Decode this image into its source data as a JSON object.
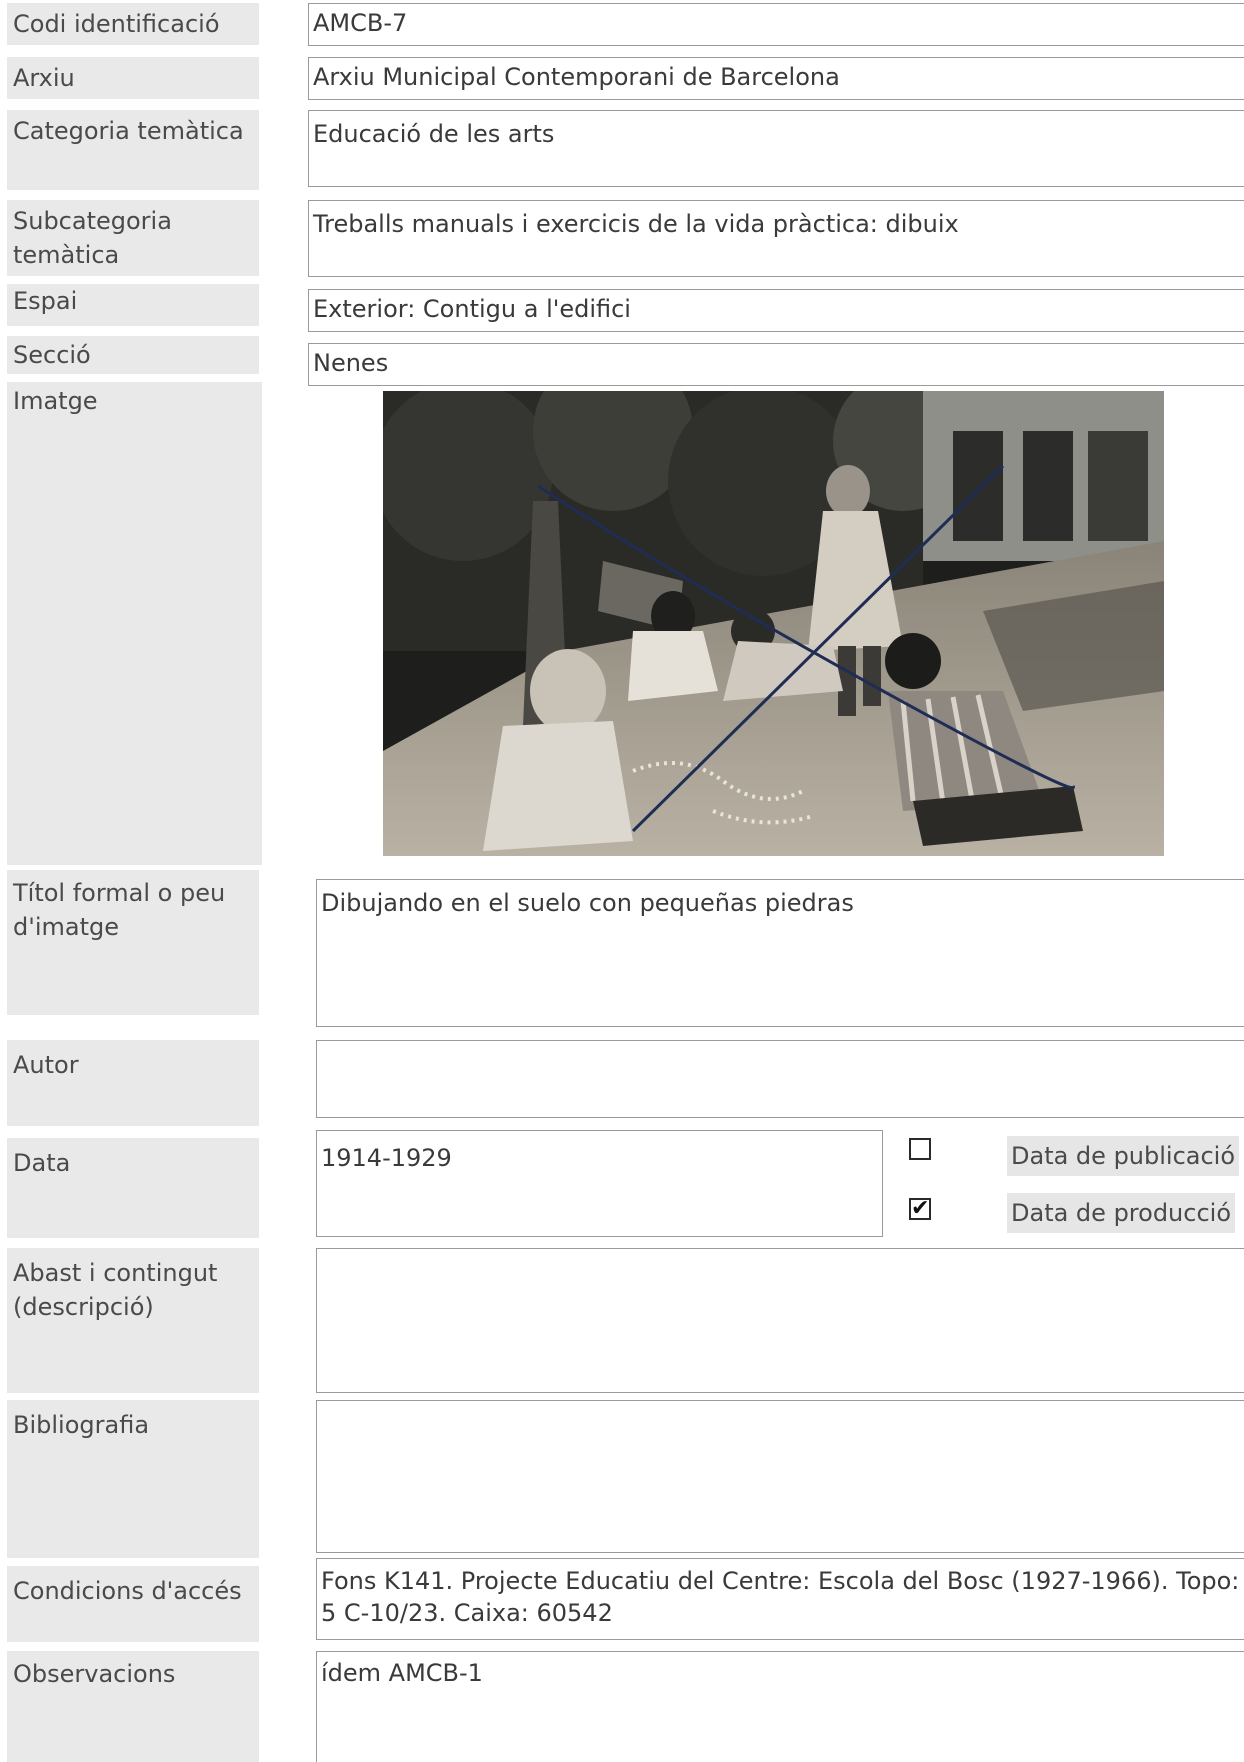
{
  "fields": {
    "codi": {
      "label": "Codi identificació",
      "value": "AMCB-7"
    },
    "arxiu": {
      "label": "Arxiu",
      "value": "Arxiu Municipal Contemporani de Barcelona"
    },
    "categoria": {
      "label": "Categoria temàtica",
      "value": "Educació de les arts"
    },
    "subcategoria": {
      "label": "Subcategoria temàtica",
      "value": "Treballs manuals i exercicis de la vida pràctica: dibuix"
    },
    "espai": {
      "label": "Espai",
      "value": "Exterior: Contigu a l'edifici"
    },
    "seccio": {
      "label": "Secció",
      "value": "Nenes"
    },
    "imatge": {
      "label": "Imatge"
    },
    "titol": {
      "label": "Títol formal o peu d'imatge",
      "value": "Dibujando en el suelo con pequeñas piedras"
    },
    "autor": {
      "label": "Autor",
      "value": ""
    },
    "data": {
      "label": "Data",
      "value": "1914-1929",
      "publicacio": {
        "label": "Data de publicació",
        "checked": false
      },
      "produccio": {
        "label": "Data de producció",
        "checked": true
      }
    },
    "abast": {
      "label": "Abast i contingut (descripció)",
      "value": ""
    },
    "bibliografia": {
      "label": "Bibliografia",
      "value": ""
    },
    "condicions": {
      "label": "Condicions d'accés",
      "value": "Fons K141. Projecte Educatiu del Centre: Escola del Bosc (1927-1966). Topo: 5 C-10/23. Caixa: 60542"
    },
    "observacions": {
      "label": "Observacions",
      "value": "ídem AMCB-1"
    }
  },
  "check_glyph": "✔",
  "colors": {
    "label_bg": "#e9e9e9",
    "field_border": "#9a9a9a",
    "text": "#3a3a3a"
  }
}
